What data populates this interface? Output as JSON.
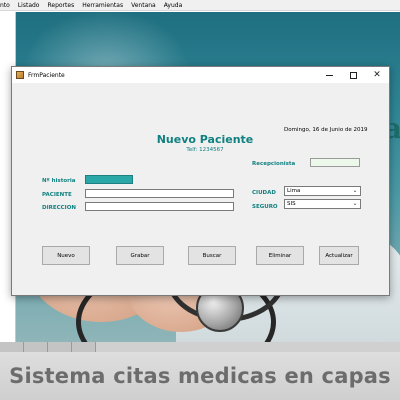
{
  "menubar": {
    "items": [
      "nto",
      "Listado",
      "Reportes",
      "Herramientas",
      "Ventana",
      "Ayuda"
    ]
  },
  "dialog": {
    "title": "FrmPaciente",
    "controls": {
      "minimize": "minimize-icon",
      "maximize": "maximize-icon",
      "close": "✕"
    }
  },
  "form": {
    "date": "Domingo, 16 de Junio de 2019",
    "title": "Nuevo Paciente",
    "phone": "Telf: 1234567",
    "labels": {
      "recepcionista": "Recepcionista",
      "historia": "Nº historia",
      "paciente": "PACIENTE",
      "direccion": "DIRECCION",
      "ciudad": "CIUDAD",
      "seguro": "SEGURO"
    },
    "values": {
      "historia": "",
      "paciente": "",
      "direccion": "",
      "recepcionista": "",
      "ciudad": "Lima",
      "seguro": "SIS"
    },
    "buttons": {
      "nuevo": "Nuevo",
      "grabar": "Grabar",
      "buscar": "Buscar",
      "eliminar": "Eliminar",
      "actualizar": "Actualizar"
    }
  },
  "banner": {
    "text": "Sistema citas medicas en capas"
  },
  "colors": {
    "accent": "#108080",
    "historia_field": "#2aa7a7",
    "recepcionista_field": "#ecf8ea",
    "dialog_bg": "#f0f0f0"
  }
}
